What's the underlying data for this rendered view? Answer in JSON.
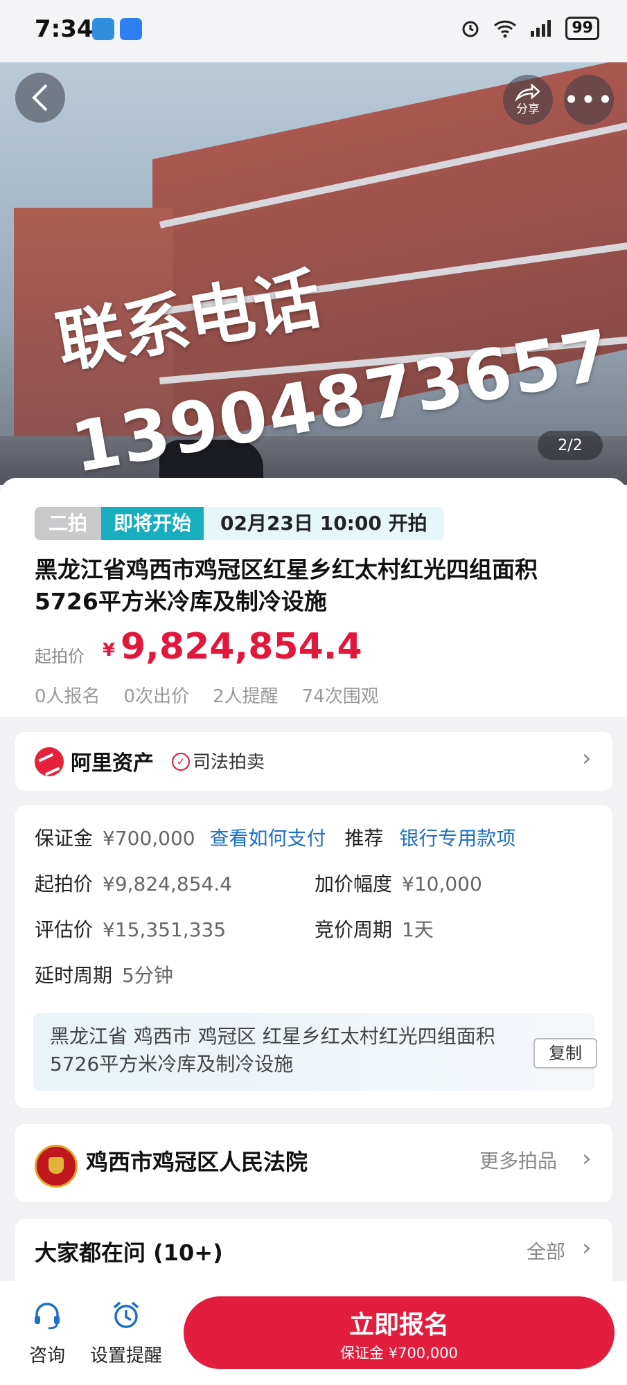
{
  "status_bar": {
    "time": "7:34",
    "battery": "99"
  },
  "hero": {
    "watermark_line1": "联系电话",
    "watermark_line2": "13904873657",
    "share_label": "分享",
    "image_counter": "2/2"
  },
  "auction": {
    "round_tag": "二拍",
    "status_tag": "即将开始",
    "start_time": "02月23日 10:00 开拍",
    "title": "黑龙江省鸡西市鸡冠区红星乡红太村红光四组面积5726平方米冷库及制冷设施",
    "price_label": "起拍价",
    "price_symbol": "¥",
    "price_value": "9,824,854.4",
    "stats": [
      "0人报名",
      "0次出价",
      "2人提醒",
      "74次围观"
    ]
  },
  "platform": {
    "name": "阿里资产",
    "badge_text": "司法拍卖"
  },
  "details": {
    "deposit_label": "保证金",
    "deposit_value": "¥700,000",
    "how_to_pay_link": "查看如何支付",
    "recommend_label": "推荐",
    "recommend_link": "银行专用款项",
    "start_price_label": "起拍价",
    "start_price_value": "¥9,824,854.4",
    "increment_label": "加价幅度",
    "increment_value": "¥10,000",
    "appraisal_label": "评估价",
    "appraisal_value": "¥15,351,335",
    "bid_period_label": "竞价周期",
    "bid_period_value": "1天",
    "extension_label": "延时周期",
    "extension_value": "5分钟",
    "address": "黑龙江省 鸡西市 鸡冠区 红星乡红太村红光四组面积5726平方米冷库及制冷设施",
    "copy_label": "复制"
  },
  "court": {
    "name": "鸡西市鸡冠区人民法院",
    "more_label": "更多拍品"
  },
  "questions": {
    "title": "大家都在问 (10+)",
    "all_label": "全部"
  },
  "bottom_bar": {
    "consult_label": "咨询",
    "reminder_label": "设置提醒",
    "cta_label": "立即报名",
    "cta_sub": "保证金 ¥700,000"
  },
  "colors": {
    "accent": "#e31d3e",
    "tag_cyan": "#18aebf",
    "link_blue": "#1e6fc7"
  }
}
